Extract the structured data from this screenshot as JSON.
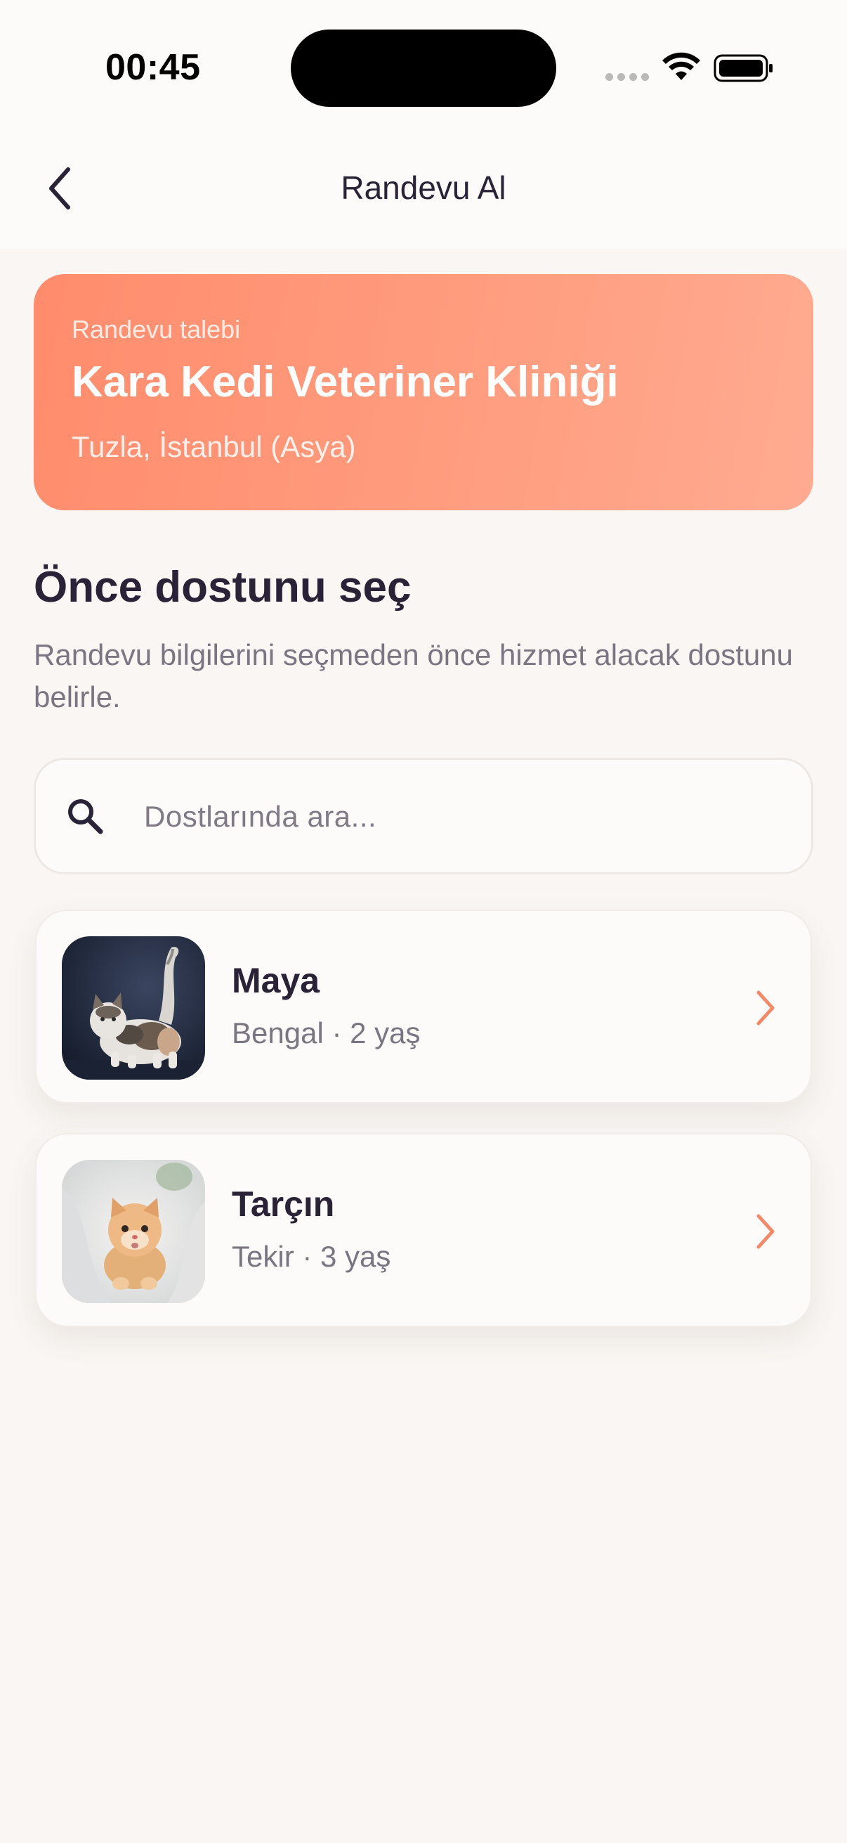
{
  "status_bar": {
    "time": "00:45"
  },
  "nav": {
    "title": "Randevu Al",
    "back_icon": "chevron-left-icon"
  },
  "clinic": {
    "label": "Randevu talebi",
    "name": "Kara Kedi Veteriner Kliniği",
    "location": "Tuzla, İstanbul (Asya)"
  },
  "section": {
    "title": "Önce dostunu seç",
    "subtitle": "Randevu bilgilerini seçmeden önce hizmet alacak dostunu belirle."
  },
  "search": {
    "placeholder": "Dostlarında ara...",
    "value": "",
    "icon": "search-icon"
  },
  "pets": [
    {
      "name": "Maya",
      "meta": "Bengal · 2 yaş",
      "icon": "chevron-right-icon"
    },
    {
      "name": "Tarçın",
      "meta": "Tekir · 3 yaş",
      "icon": "chevron-right-icon"
    }
  ],
  "colors": {
    "accent": "#ff8c6c",
    "text_primary": "#2a2236",
    "text_secondary": "#7b7582",
    "background": "#f9f6f3"
  }
}
